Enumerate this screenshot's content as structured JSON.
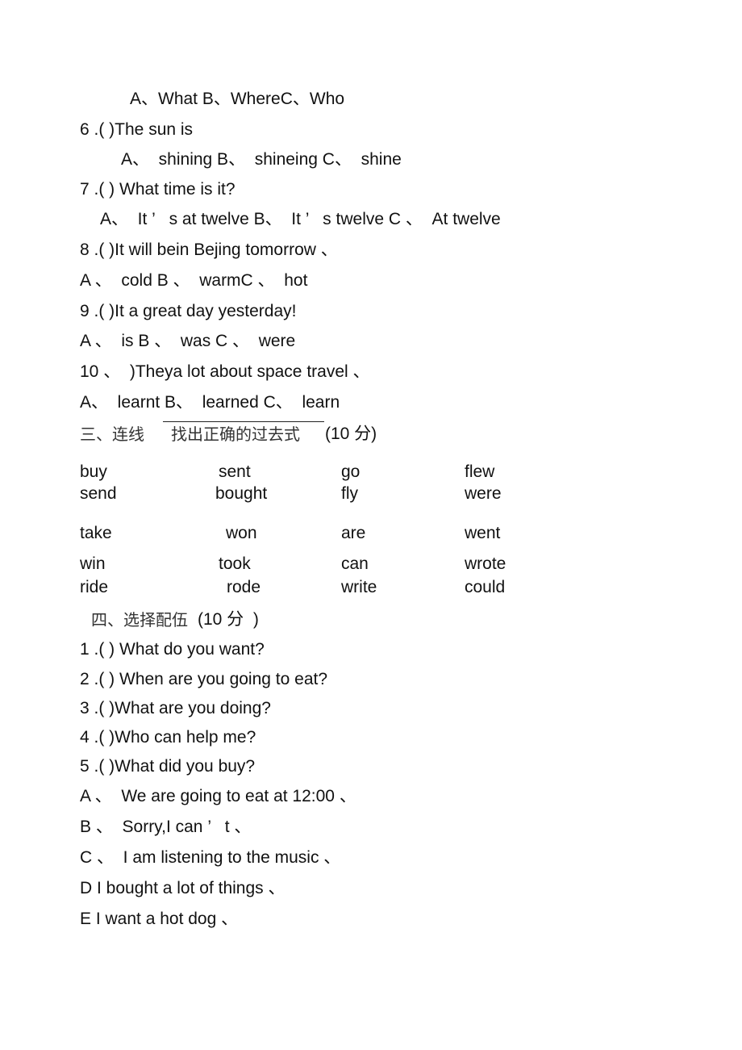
{
  "section2_tail": {
    "q5_options": "A、What B、WhereC、Who",
    "questions": [
      {
        "stem": "6 .( )The sun is",
        "options": "A、  shining B、  shineing C、  shine"
      },
      {
        "stem": "7 .( ) What time is it?",
        "options": "A、  It ’   s at twelve B、  It ’   s twelve C 、  At twelve"
      },
      {
        "stem": "8 .( )It will bein Bejing tomorrow 、",
        "options": "A 、  cold B 、  warmC 、  hot"
      },
      {
        "stem": "9 .( )It a great day yesterday!",
        "options": "A 、  is B 、  was C 、  were"
      },
      {
        "stem": "10 、  )Theya lot about space travel 、",
        "options": "A、  learnt B、  learned C、  learn"
      }
    ]
  },
  "section3": {
    "prefix": "三、连线",
    "instruction": "找出正确的过去式",
    "points": "(10 分)",
    "rows": [
      [
        "buy",
        "sent",
        "go",
        "flew"
      ],
      [
        "send",
        "bought",
        "fly",
        "were"
      ],
      [
        "take",
        "won",
        "are",
        "went"
      ],
      [
        "win",
        "took",
        "can",
        "wrote"
      ],
      [
        "ride",
        "rode",
        "write",
        "could"
      ]
    ]
  },
  "section4": {
    "title_cn": "四、选择配伍",
    "title_pts": "(10 分  )",
    "questions": [
      "1 .( ) What do you want?",
      "2 .( ) When are you going to eat?",
      "3 .( )What are you doing?",
      "4 .( )Who can help me?",
      "5 .( )What did you buy?"
    ],
    "answers": [
      "A 、  We are going to eat at 12:00 、",
      "B 、  Sorry,I can ’   t 、",
      "C 、  I am listening to the music 、",
      "D I bought a lot of things 、",
      "E I want a hot dog 、"
    ]
  }
}
